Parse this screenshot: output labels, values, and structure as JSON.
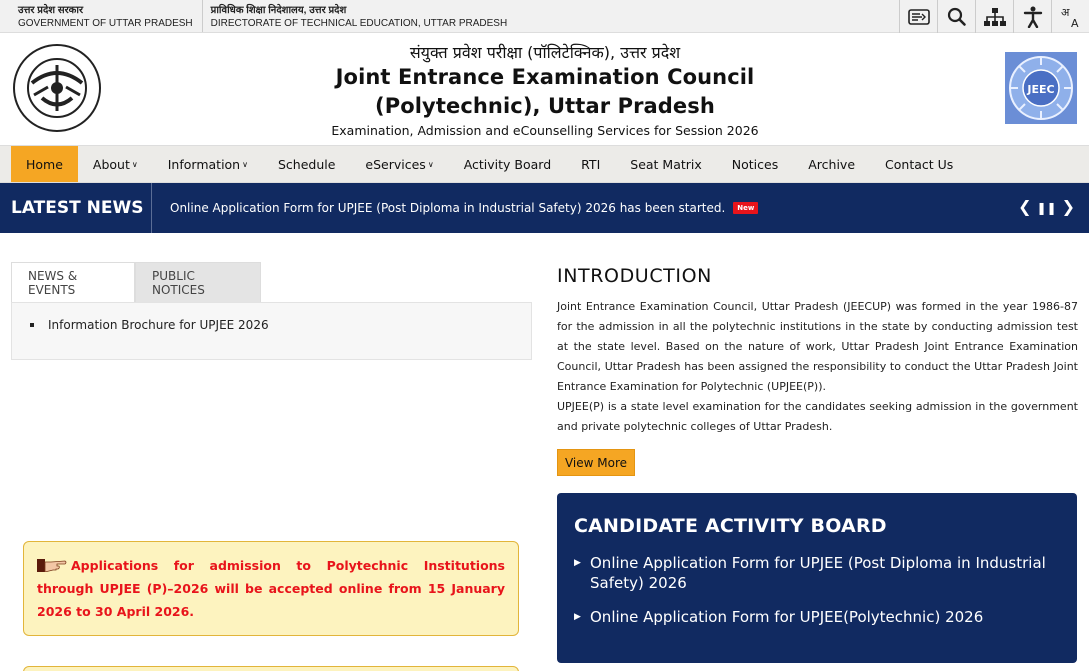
{
  "govbar": {
    "left_hindi": "उत्तर प्रदेश सरकार",
    "left_english": "GOVERNMENT OF UTTAR PRADESH",
    "right_hindi": "प्राविधिक शिक्षा निदेशालय, उत्तर प्रदेश",
    "right_english": "DIRECTORATE OF TECHNICAL EDUCATION, UTTAR PRADESH",
    "tools": [
      "skip-to-content-icon",
      "search-icon",
      "sitemap-icon",
      "accessibility-icon",
      "language-icon"
    ]
  },
  "header": {
    "hindi_title": "संयुक्त प्रवेश परीक्षा (पॉलिटेक्निक), उत्तर प्रदेश",
    "title_line1": "Joint Entrance Examination Council",
    "title_line2": "(Polytechnic), Uttar Pradesh",
    "subtitle": "Examination, Admission and eCounselling Services for Session 2026",
    "emblem_text": "उत्तर प्रदेश सरकार",
    "jeec_logo_text": "JEEC"
  },
  "nav": {
    "items": [
      {
        "label": "Home",
        "dropdown": false
      },
      {
        "label": "About",
        "dropdown": true
      },
      {
        "label": "Information",
        "dropdown": true
      },
      {
        "label": "Schedule",
        "dropdown": false
      },
      {
        "label": "eServices",
        "dropdown": true
      },
      {
        "label": "Activity Board",
        "dropdown": false
      },
      {
        "label": "RTI",
        "dropdown": false
      },
      {
        "label": "Seat Matrix",
        "dropdown": false
      },
      {
        "label": "Notices",
        "dropdown": false
      },
      {
        "label": "Archive",
        "dropdown": false
      },
      {
        "label": "Contact Us",
        "dropdown": false
      }
    ],
    "active": "Home"
  },
  "ticker": {
    "label": "LATEST NEWS",
    "text": "Online Application Form for UPJEE (Post Diploma in Industrial Safety) 2026 has been started.",
    "badge": "New"
  },
  "tabs": {
    "items": [
      "NEWS & EVENTS",
      "PUBLIC NOTICES"
    ],
    "active": "NEWS & EVENTS",
    "news": [
      "Information Brochure for UPJEE 2026"
    ]
  },
  "notice": {
    "text": "Applications for admission to Polytechnic Institutions through UPJEE (P)–2026 will be accepted online from 15 January 2026 to 30 April 2026."
  },
  "intro": {
    "heading": "INTRODUCTION",
    "para1": "Joint Entrance Examination Council, Uttar Pradesh (JEECUP) was formed in the year 1986-87 for the admission in all the polytechnic institutions in the state by conducting admission test at the state level. Based on the nature of work, Uttar Pradesh Joint Entrance Examination Council, Uttar Pradesh has been assigned the responsibility to conduct the Uttar Pradesh Joint Entrance Examination for Polytechnic (UPJEE(P)).",
    "para2": "UPJEE(P) is a state level examination for the candidates seeking admission in the government and private polytechnic colleges of Uttar Pradesh.",
    "view_more": "View More"
  },
  "board": {
    "heading": "CANDIDATE ACTIVITY BOARD",
    "items": [
      "Online Application Form for UPJEE (Post Diploma in Industrial Safety) 2026",
      "Online Application Form for UPJEE(Polytechnic) 2026"
    ]
  },
  "colors": {
    "navy": "#112a61",
    "accent_orange": "#f5a623",
    "notice_red": "#e8141b",
    "notice_bg": "#fdf3bf"
  }
}
